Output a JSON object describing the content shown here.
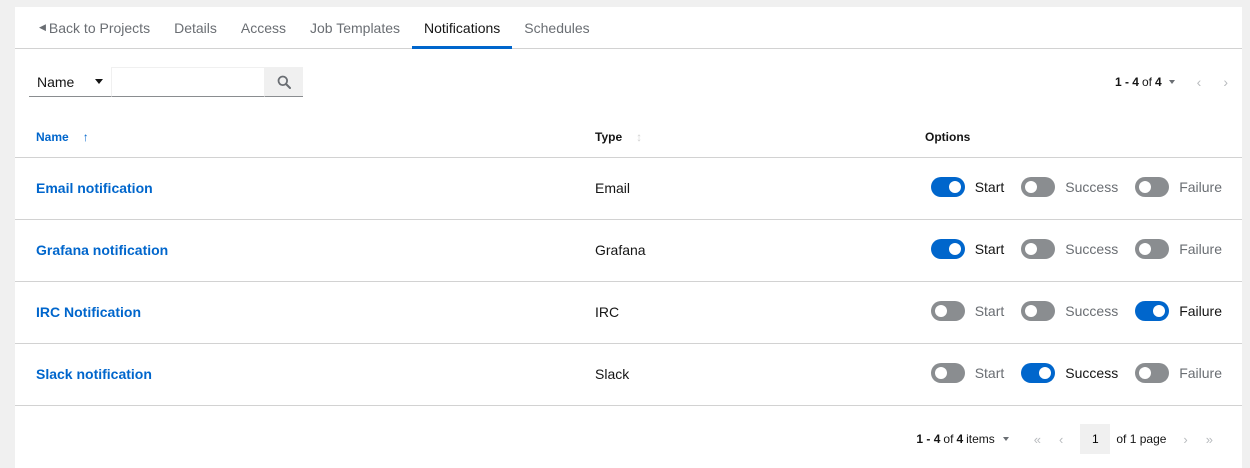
{
  "tabs": [
    {
      "label": "Back to Projects",
      "active": false
    },
    {
      "label": "Details",
      "active": false
    },
    {
      "label": "Access",
      "active": false
    },
    {
      "label": "Job Templates",
      "active": false
    },
    {
      "label": "Notifications",
      "active": true
    },
    {
      "label": "Schedules",
      "active": false
    }
  ],
  "toolbar": {
    "filter_label": "Name",
    "search_value": "",
    "search_icon": "search-icon",
    "pagination": {
      "range": "1 - 4",
      "of": "of",
      "total": "4"
    }
  },
  "table": {
    "headers": {
      "name": "Name",
      "type": "Type",
      "options": "Options"
    },
    "sort": {
      "column": "name",
      "direction": "ascending"
    },
    "rows": [
      {
        "name": "Email notification",
        "type": "Email",
        "toggles": [
          {
            "label": "Start",
            "on": true
          },
          {
            "label": "Success",
            "on": false
          },
          {
            "label": "Failure",
            "on": false
          }
        ]
      },
      {
        "name": "Grafana notification",
        "type": "Grafana",
        "toggles": [
          {
            "label": "Start",
            "on": true
          },
          {
            "label": "Success",
            "on": false
          },
          {
            "label": "Failure",
            "on": false
          }
        ]
      },
      {
        "name": "IRC Notification",
        "type": "IRC",
        "toggles": [
          {
            "label": "Start",
            "on": false
          },
          {
            "label": "Success",
            "on": false
          },
          {
            "label": "Failure",
            "on": true
          }
        ]
      },
      {
        "name": "Slack notification",
        "type": "Slack",
        "toggles": [
          {
            "label": "Start",
            "on": false
          },
          {
            "label": "Success",
            "on": true
          },
          {
            "label": "Failure",
            "on": false
          }
        ]
      }
    ]
  },
  "bottom_pagination": {
    "range": "1 - 4",
    "of": "of",
    "total": "4",
    "items_label": "items",
    "current_page": "1",
    "pages_label": "of 1 page"
  },
  "colors": {
    "accent": "#0066cc",
    "toggle_off": "#8a8d90",
    "border": "#d2d2d2",
    "background": "#f0f0f0"
  }
}
